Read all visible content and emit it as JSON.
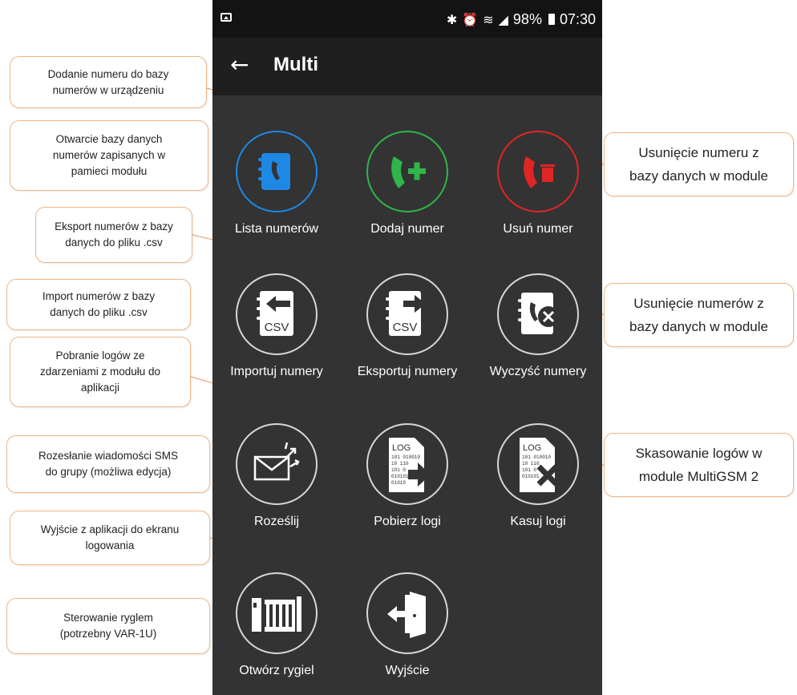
{
  "status": {
    "percent": "98%",
    "time": "07:30",
    "icons": [
      "image-icon",
      "bluetooth-icon",
      "alarm-icon",
      "wifi-icon",
      "signal-icon",
      "battery-icon"
    ]
  },
  "appbar": {
    "title": "Multi",
    "back_icon": "back-arrow-icon"
  },
  "colors": {
    "blue": "#1e88e5",
    "green": "#2fb54a",
    "red": "#e02525",
    "screen_bg": "#333333",
    "callout_border": "#f0b585"
  },
  "tiles": [
    {
      "label": "Lista numerów",
      "icon": "phonebook-icon"
    },
    {
      "label": "Dodaj numer",
      "icon": "add-call-icon"
    },
    {
      "label": "Usuń numer",
      "icon": "delete-call-icon"
    },
    {
      "label": "Importuj numery",
      "icon": "import-csv-icon"
    },
    {
      "label": "Eksportuj numery",
      "icon": "export-csv-icon"
    },
    {
      "label": "Wyczyść numery",
      "icon": "clear-numbers-icon"
    },
    {
      "label": "Roześlij",
      "icon": "send-sms-icon"
    },
    {
      "label": "Pobierz logi",
      "icon": "download-logs-icon"
    },
    {
      "label": "Kasuj logi",
      "icon": "delete-logs-icon"
    },
    {
      "label": "Otwórz rygiel",
      "icon": "gate-icon"
    },
    {
      "label": "Wyjście",
      "icon": "exit-door-icon"
    }
  ],
  "callouts": {
    "add": "Dodanie numeru do bazy\nnumerów w urządzeniu",
    "list": "Otwarcie bazy danych\nnumerów zapisanych w\npamieci modułu",
    "export": "Eksport numerów z bazy\ndanych do pliku .csv",
    "import": "Import numerów z bazy\ndanych do pliku .csv",
    "logs_download": "Pobranie logów ze\nzdarzeniami z modułu do\naplikacji",
    "sms": "Rozesłanie wiadomości SMS\ndo grupy (możliwa edycja)",
    "exit": "Wyjście z aplikacji do ekranu\nlogowania",
    "gate": "Sterowanie ryglem\n(potrzebny VAR-1U)",
    "delete": "Usunięcie numeru z\nbazy danych w module",
    "clear": "Usunięcie numerów z\nbazy danych w module",
    "logs_delete": "Skasowanie logów w\nmodule MultiGSM 2"
  },
  "icon_text": {
    "csv": "CSV",
    "log": "LOG",
    "bits": [
      "101 010010",
      "10 110",
      "101 0",
      "010101",
      "01010"
    ]
  }
}
